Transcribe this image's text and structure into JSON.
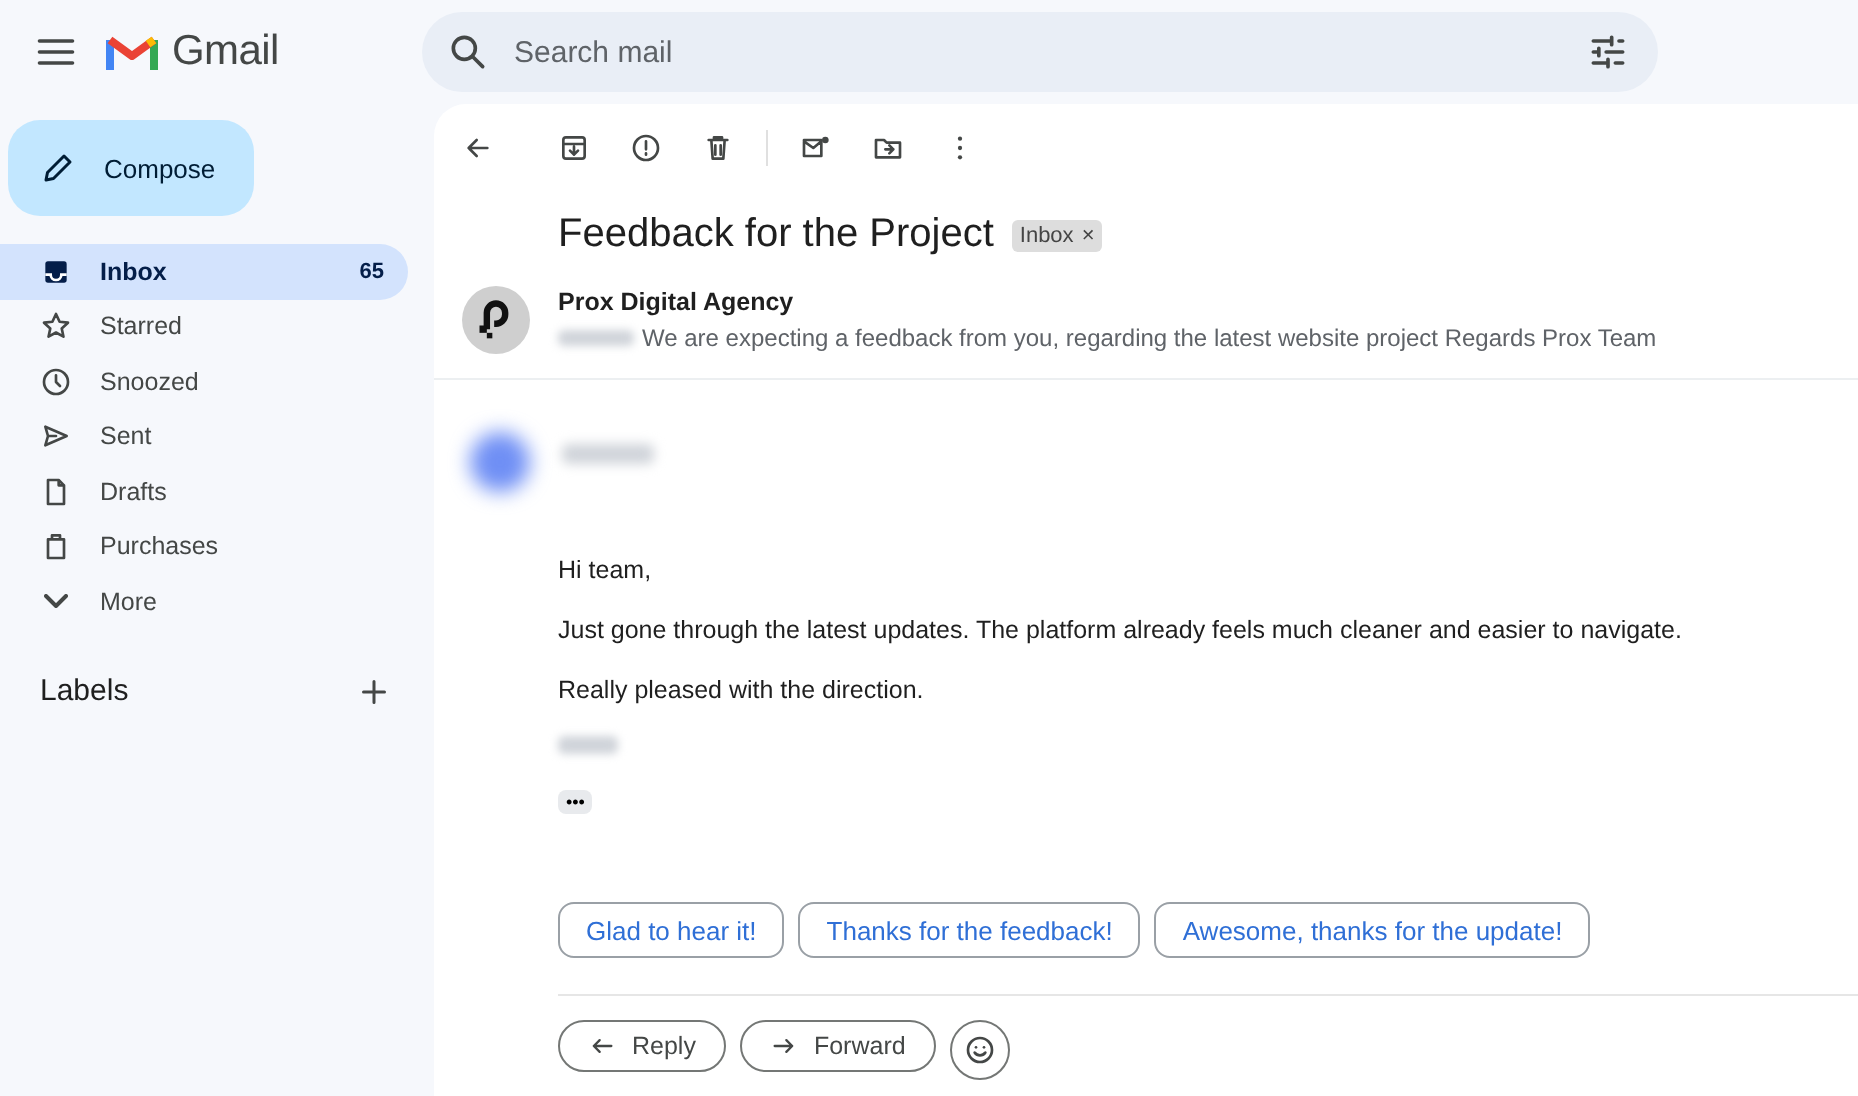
{
  "app": {
    "name": "Gmail"
  },
  "search": {
    "placeholder": "Search mail"
  },
  "compose": {
    "label": "Compose"
  },
  "nav": [
    {
      "label": "Inbox",
      "count": "65",
      "kind": "inbox",
      "selected": true
    },
    {
      "label": "Starred",
      "kind": "star",
      "selected": false
    },
    {
      "label": "Snoozed",
      "kind": "clock",
      "selected": false
    },
    {
      "label": "Sent",
      "kind": "send",
      "selected": false
    },
    {
      "label": "Drafts",
      "kind": "draft",
      "selected": false
    },
    {
      "label": "Purchases",
      "kind": "bag",
      "selected": false
    },
    {
      "label": "More",
      "kind": "chevron",
      "selected": false
    }
  ],
  "labels": {
    "title": "Labels"
  },
  "email": {
    "subject": "Feedback for the Project",
    "tag": {
      "label": "Inbox",
      "remove": "×"
    },
    "collapsed_message": {
      "sender": "Prox Digital Agency",
      "snippet": "We are expecting a feedback from you, regarding the latest website project Regards Prox Team"
    },
    "body": [
      "Hi team,",
      "Just gone through the latest updates. The platform already feels much cleaner and easier to navigate.",
      "Really pleased with the direction."
    ],
    "trimmed_content": "•••",
    "smart_replies": [
      "Glad to hear it!",
      "Thanks for the feedback!",
      "Awesome, thanks for the update!"
    ],
    "actions": [
      {
        "kind": "reply",
        "label": "Reply"
      },
      {
        "kind": "forward",
        "label": "Forward"
      },
      {
        "kind": "emoji"
      }
    ]
  }
}
